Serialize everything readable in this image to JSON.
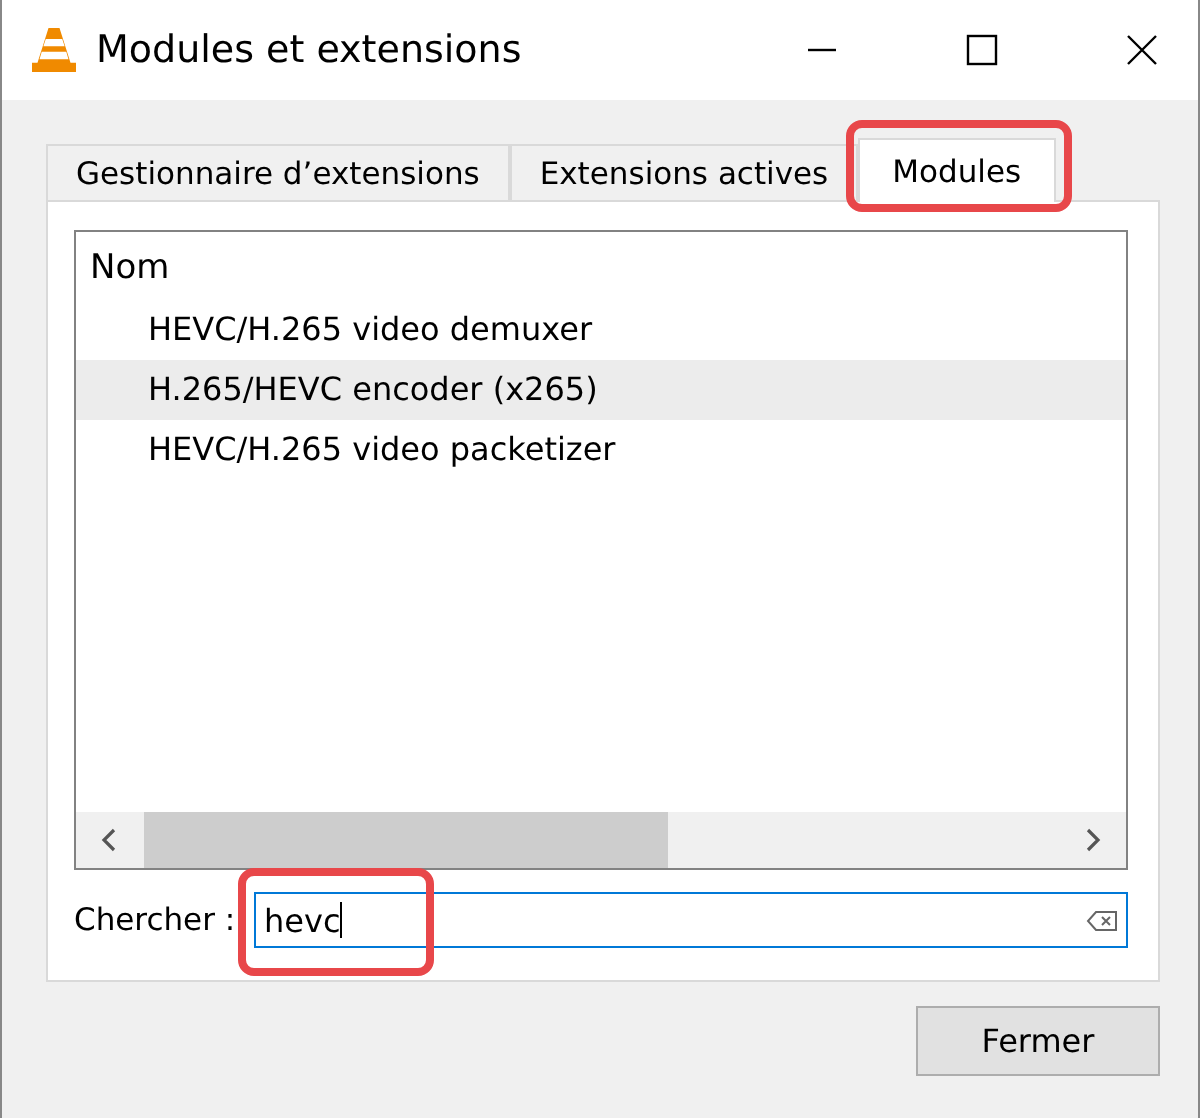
{
  "window": {
    "title": "Modules et extensions"
  },
  "tabs": [
    {
      "label": "Gestionnaire d’extensions",
      "selected": false,
      "highlighted": false
    },
    {
      "label": "Extensions actives",
      "selected": false,
      "highlighted": false
    },
    {
      "label": "Modules",
      "selected": true,
      "highlighted": true
    }
  ],
  "list": {
    "header": "Nom",
    "rows": [
      {
        "name": "HEVC/H.265 video demuxer",
        "selected": false
      },
      {
        "name": "H.265/HEVC encoder (x265)",
        "selected": true
      },
      {
        "name": "HEVC/H.265 video packetizer",
        "selected": false
      }
    ]
  },
  "search": {
    "label": "Chercher :",
    "value": "hevc",
    "highlighted": true
  },
  "buttons": [
    "Fermer"
  ]
}
